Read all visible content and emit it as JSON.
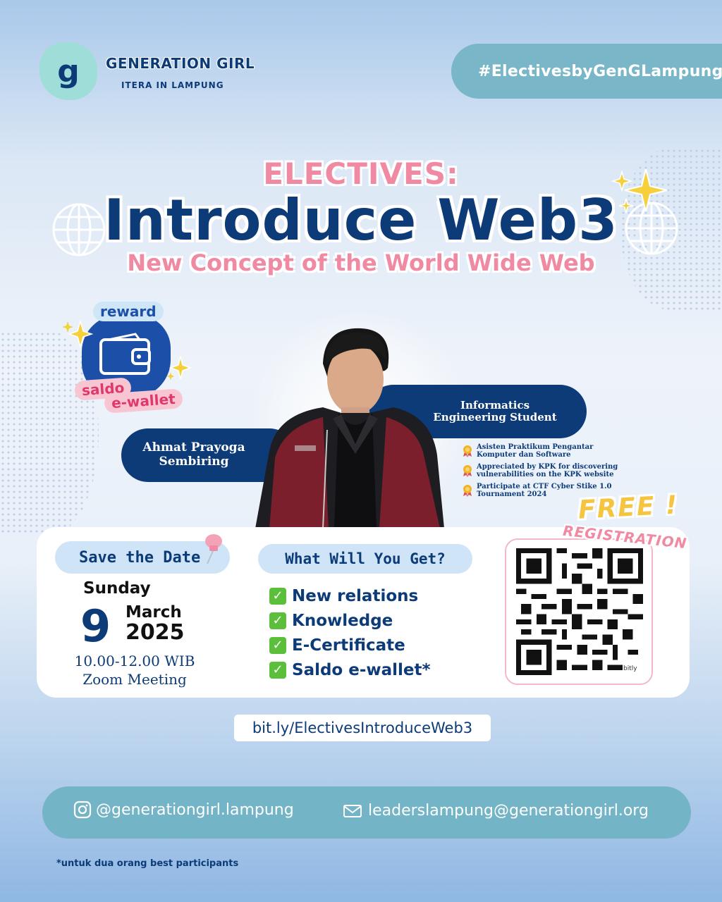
{
  "brand": {
    "logo_letter": "g",
    "name": "GENERATION GIRL",
    "subtitle": "ITERA IN LAMPUNG"
  },
  "hashtag": "#ElectivesbyGenGLampung",
  "title": {
    "kicker": "ELECTIVES:",
    "main": "Introduce Web3",
    "subtitle": "New Concept of the World Wide Web"
  },
  "reward": {
    "label": "reward",
    "line1": "saldo",
    "line2": "e-wallet"
  },
  "speaker": {
    "name": "Ahmat Prayoga Sembiring",
    "role": "Informatics Engineering Student",
    "achievements": [
      "Asisten Praktikum Pengantar Komputer dan Software",
      "Appreciated by KPK for discovering vulnerabilities on the KPK website",
      "Participate at CTF Cyber Stike 1.0 Tournament 2024"
    ]
  },
  "schedule": {
    "heading": "Save the Date",
    "day": "Sunday",
    "date": "9",
    "month": "March",
    "year": "2025",
    "time": "10.00-12.00 WIB",
    "venue": "Zoom Meeting"
  },
  "benefits": {
    "heading": "What Will You Get?",
    "items": [
      "New relations",
      "Knowledge",
      "E-Certificate",
      "Saldo e-wallet*"
    ]
  },
  "registration": {
    "free": "FREE !",
    "label": "REGISTRATION",
    "qr_brand": "bitly"
  },
  "link": "bit.ly/ElectivesIntroduceWeb3",
  "contact": {
    "instagram": "@generationgirl.lampung",
    "email": "leaderslampung@generationgirl.org"
  },
  "footnote": "*untuk dua orang best participants",
  "colors": {
    "navy": "#0d3b78",
    "pink": "#f08aa3",
    "teal": "#73b4c6",
    "mint": "#9fded8",
    "gold": "#f5c542",
    "check_green": "#5bbf3c"
  }
}
